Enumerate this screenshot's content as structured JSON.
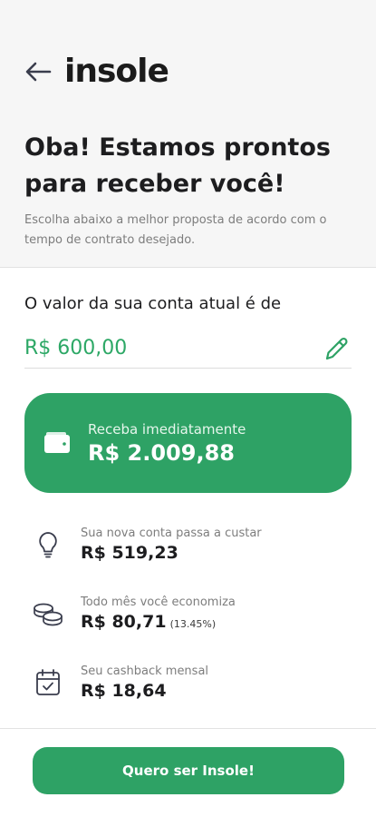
{
  "header": {
    "brand": "insole"
  },
  "headline": "Oba! Estamos prontos para receber você!",
  "subtitle": "Escolha abaixo a melhor proposta de acordo com o tempo de contrato desejado.",
  "account": {
    "label": "O valor da sua conta atual é de",
    "value": "R$ 600,00"
  },
  "offer": {
    "label": "Receba imediatamente",
    "value": "R$ 2.009,88"
  },
  "details": [
    {
      "icon": "lightbulb-icon",
      "label": "Sua nova conta passa a custar",
      "value": "R$ 519,23",
      "extra": ""
    },
    {
      "icon": "coins-icon",
      "label": "Todo mês você economiza",
      "value": "R$ 80,71",
      "extra": "(13.45%)"
    },
    {
      "icon": "calendar-check-icon",
      "label": "Seu cashback mensal",
      "value": "R$ 18,64",
      "extra": ""
    }
  ],
  "cta": {
    "label": "Quero ser Insole!"
  },
  "colors": {
    "brand_green": "#2ea265",
    "value_green": "#2da866",
    "text_dark": "#1d1d1f",
    "text_muted": "#7d7d7d",
    "background_top": "#f6f6f6"
  }
}
